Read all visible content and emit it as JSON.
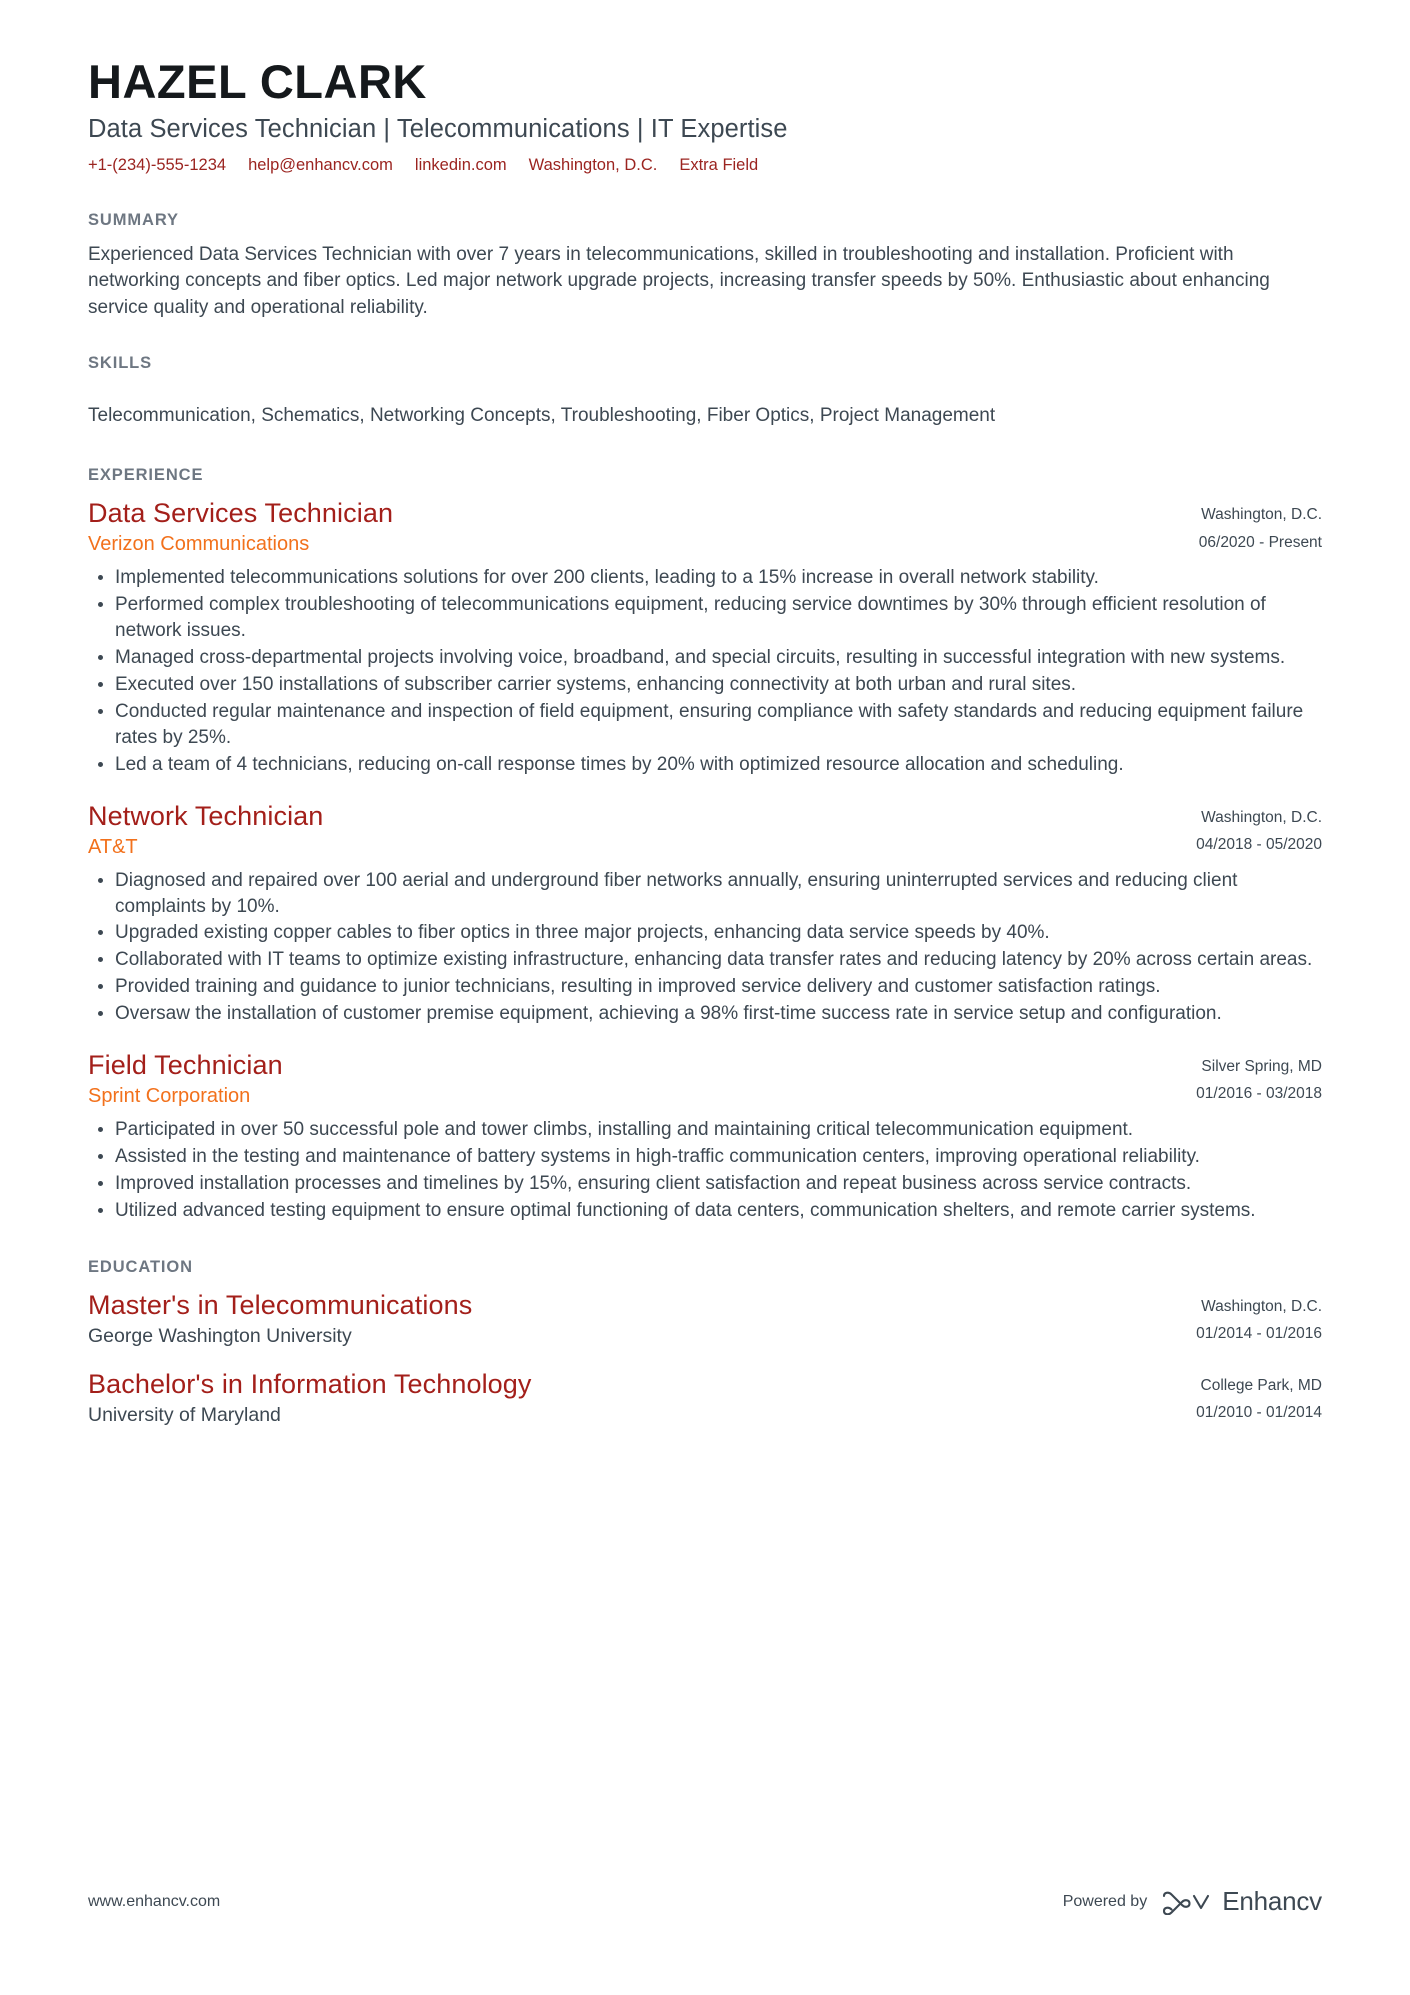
{
  "header": {
    "full_name": "HAZEL CLARK",
    "headline": "Data Services Technician | Telecommunications | IT Expertise",
    "contacts": [
      {
        "name": "phone",
        "value": "+1-(234)-555-1234"
      },
      {
        "name": "email",
        "value": "help@enhancv.com"
      },
      {
        "name": "linkedin",
        "value": "linkedin.com"
      },
      {
        "name": "location",
        "value": "Washington, D.C."
      },
      {
        "name": "extra",
        "value": "Extra Field"
      }
    ],
    "accent_color": "#9b2420"
  },
  "summary": {
    "title": "SUMMARY",
    "text": "Experienced Data Services Technician with over 7 years in telecommunications, skilled in troubleshooting and installation. Proficient with networking concepts and fiber optics. Led major network upgrade projects, increasing transfer speeds by 50%. Enthusiastic about enhancing service quality and operational reliability."
  },
  "skills": {
    "title": "SKILLS",
    "text": "Telecommunication, Schematics, Networking Concepts, Troubleshooting, Fiber Optics, Project Management"
  },
  "experience": {
    "title": "EXPERIENCE",
    "entries": [
      {
        "title": "Data Services Technician",
        "company": "Verizon Communications",
        "location": "Washington, D.C.",
        "dates": "06/2020 - Present",
        "bullets": [
          "Implemented telecommunications solutions for over 200 clients, leading to a 15% increase in overall network stability.",
          "Performed complex troubleshooting of telecommunications equipment, reducing service downtimes by 30% through efficient resolution of network issues.",
          "Managed cross-departmental projects involving voice, broadband, and special circuits, resulting in successful integration with new systems.",
          "Executed over 150 installations of subscriber carrier systems, enhancing connectivity at both urban and rural sites.",
          "Conducted regular maintenance and inspection of field equipment, ensuring compliance with safety standards and reducing equipment failure rates by 25%.",
          "Led a team of 4 technicians, reducing on-call response times by 20% with optimized resource allocation and scheduling."
        ]
      },
      {
        "title": "Network Technician",
        "company": "AT&T",
        "location": "Washington, D.C.",
        "dates": "04/2018 - 05/2020",
        "bullets": [
          "Diagnosed and repaired over 100 aerial and underground fiber networks annually, ensuring uninterrupted services and reducing client complaints by 10%.",
          "Upgraded existing copper cables to fiber optics in three major projects, enhancing data service speeds by 40%.",
          "Collaborated with IT teams to optimize existing infrastructure, enhancing data transfer rates and reducing latency by 20% across certain areas.",
          "Provided training and guidance to junior technicians, resulting in improved service delivery and customer satisfaction ratings.",
          "Oversaw the installation of customer premise equipment, achieving a 98% first-time success rate in service setup and configuration."
        ]
      },
      {
        "title": "Field Technician",
        "company": "Sprint Corporation",
        "location": "Silver Spring, MD",
        "dates": "01/2016 - 03/2018",
        "bullets": [
          "Participated in over 50 successful pole and tower climbs, installing and maintaining critical telecommunication equipment.",
          "Assisted in the testing and maintenance of battery systems in high-traffic communication centers, improving operational reliability.",
          "Improved installation processes and timelines by 15%, ensuring client satisfaction and repeat business across service contracts.",
          "Utilized advanced testing equipment to ensure optimal functioning of data centers, communication shelters, and remote carrier systems."
        ]
      }
    ]
  },
  "education": {
    "title": "EDUCATION",
    "entries": [
      {
        "degree": "Master's in Telecommunications",
        "school": "George Washington University",
        "location": "Washington, D.C.",
        "dates": "01/2014 - 01/2016"
      },
      {
        "degree": "Bachelor's in Information Technology",
        "school": "University of Maryland",
        "location": "College Park, MD",
        "dates": "01/2010 - 01/2014"
      }
    ]
  },
  "footer": {
    "url": "www.enhancv.com",
    "powered_by": "Powered by",
    "brand": "Enhancv"
  }
}
